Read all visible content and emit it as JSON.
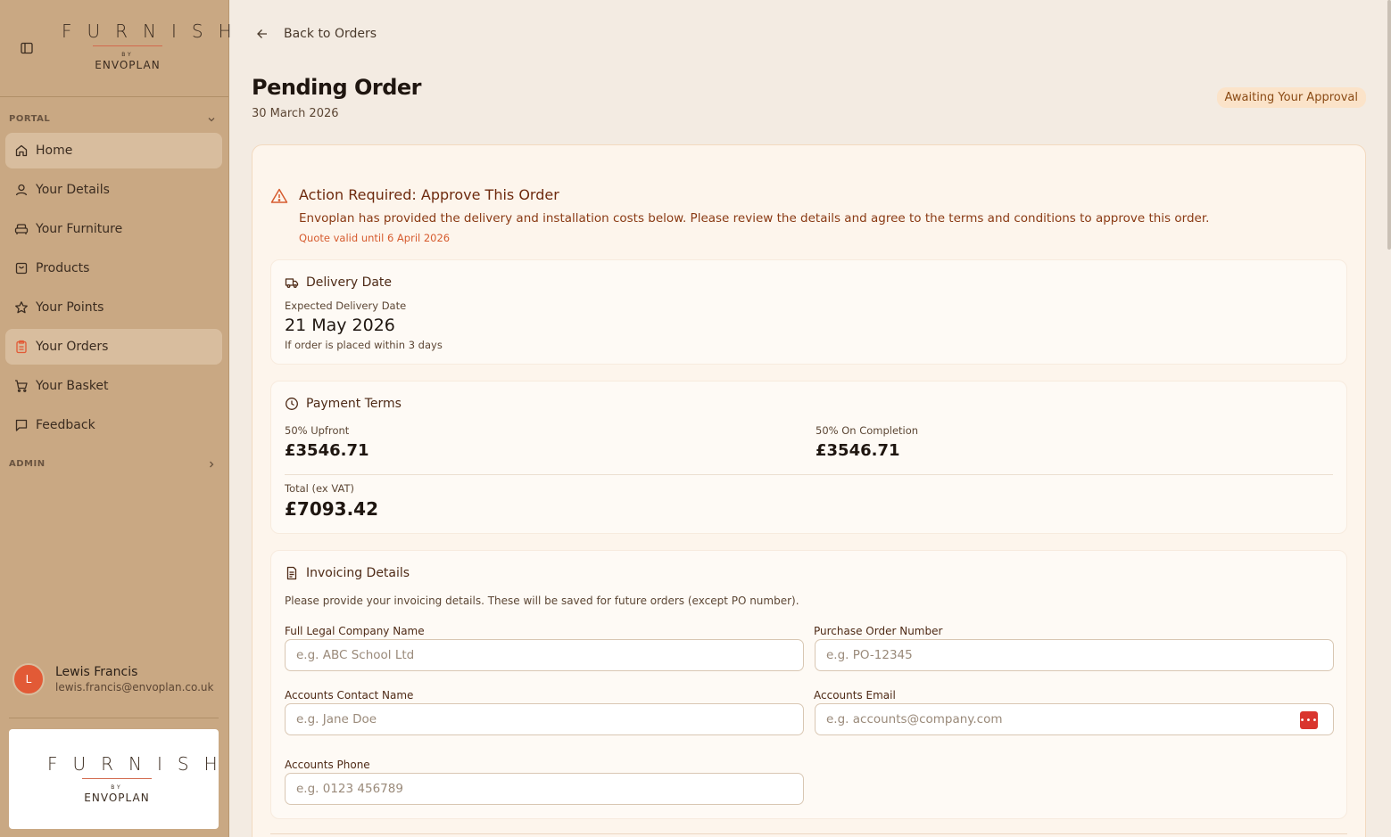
{
  "brand": {
    "word": "FURNISH",
    "by": "BY",
    "company": "ENVOPLAN"
  },
  "sidebar": {
    "portal_label": "PORTAL",
    "admin_label": "ADMIN",
    "items": [
      {
        "label": "Home",
        "icon": "home-icon"
      },
      {
        "label": "Your Details",
        "icon": "user-icon"
      },
      {
        "label": "Your Furniture",
        "icon": "sofa-icon"
      },
      {
        "label": "Products",
        "icon": "bag-icon"
      },
      {
        "label": "Your Points",
        "icon": "star-icon"
      },
      {
        "label": "Your Orders",
        "icon": "clipboard-icon",
        "active": true
      },
      {
        "label": "Your Basket",
        "icon": "cart-icon"
      },
      {
        "label": "Feedback",
        "icon": "message-icon"
      }
    ],
    "user": {
      "initial": "L",
      "name": "Lewis Francis",
      "email": "lewis.francis@envoplan.co.uk"
    }
  },
  "header": {
    "back_label": "Back to Orders",
    "title": "Pending Order",
    "date": "30 March 2026",
    "status": "Awaiting Your Approval"
  },
  "alert": {
    "title": "Action Required: Approve This Order",
    "text": "Envoplan has provided the delivery and installation costs below. Please review the details and agree to the terms and conditions to approve this order.",
    "valid": "Quote valid until 6 April 2026"
  },
  "delivery": {
    "heading": "Delivery Date",
    "label": "Expected Delivery Date",
    "date": "21 May 2026",
    "note": "If order is placed within 3 days"
  },
  "payment": {
    "heading": "Payment Terms",
    "upfront_label": "50% Upfront",
    "upfront_value": "£3546.71",
    "completion_label": "50% On Completion",
    "completion_value": "£3546.71",
    "total_label": "Total (ex VAT)",
    "total_value": "£7093.42"
  },
  "invoicing": {
    "heading": "Invoicing Details",
    "description": "Please provide your invoicing details. These will be saved for future orders (except PO number).",
    "fields": {
      "company": {
        "label": "Full Legal Company Name",
        "placeholder": "e.g. ABC School Ltd"
      },
      "po": {
        "label": "Purchase Order Number",
        "placeholder": "e.g. PO-12345"
      },
      "contact": {
        "label": "Accounts Contact Name",
        "placeholder": "e.g. Jane Doe"
      },
      "email": {
        "label": "Accounts Email",
        "placeholder": "e.g. accounts@company.com"
      },
      "phone": {
        "label": "Accounts Phone",
        "placeholder": "e.g. 0123 456789"
      }
    }
  },
  "colors": {
    "sidebar": "#c9a883",
    "accent": "#e25a36",
    "alert": "#8a3a14",
    "background": "#f3ebe2"
  }
}
